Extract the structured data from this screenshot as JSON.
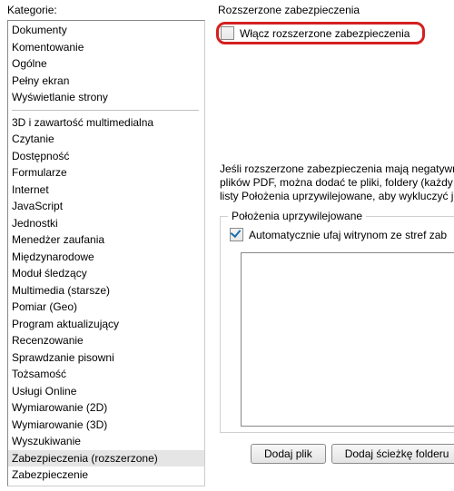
{
  "left": {
    "title": "Kategorie:",
    "group1": [
      "Dokumenty",
      "Komentowanie",
      "Ogólne",
      "Pełny ekran",
      "Wyświetlanie strony"
    ],
    "group2": [
      "3D i zawartość multimedialna",
      "Czytanie",
      "Dostępność",
      "Formularze",
      "Internet",
      "JavaScript",
      "Jednostki",
      "Menedżer zaufania",
      "Międzynarodowe",
      "Moduł śledzący",
      "Multimedia (starsze)",
      "Pomiar (Geo)",
      "Program aktualizujący",
      "Recenzowanie",
      "Sprawdzanie pisowni",
      "Tożsamość",
      "Usługi Online",
      "Wymiarowanie (2D)",
      "Wymiarowanie (3D)",
      "Wyszukiwanie",
      "Zabezpieczenia (rozszerzone)",
      "Zabezpieczenie"
    ],
    "selected": "Zabezpieczenia (rozszerzone)"
  },
  "right": {
    "title": "Rozszerzone zabezpieczenia",
    "enable_label": "Włącz rozszerzone zabezpieczenia",
    "enable_checked": false,
    "description": "Jeśli rozszerzone zabezpieczenia mają negatywny\nplików PDF, można dodać te pliki, foldery (każdy\nlisty Położenia uprzywilejowane, aby wykluczyć j",
    "group": {
      "title": "Położenia uprzywilejowane",
      "auto_trust_label": "Automatycznie ufaj witrynom ze stref zab",
      "auto_trust_checked": true
    },
    "buttons": {
      "add_file": "Dodaj plik",
      "add_folder": "Dodaj ścieżkę folderu"
    }
  }
}
